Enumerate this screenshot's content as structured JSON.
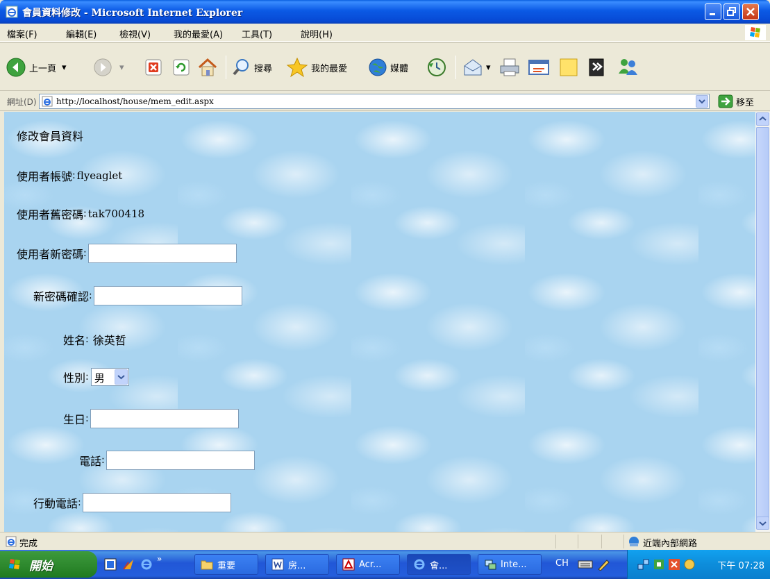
{
  "window": {
    "title": "會員資料修改 - Microsoft Internet Explorer"
  },
  "menu": [
    "檔案(F)",
    "編輯(E)",
    "檢視(V)",
    "我的最愛(A)",
    "工具(T)",
    "說明(H)"
  ],
  "toolbar": {
    "back_label": "上一頁",
    "search_label": "搜尋",
    "favorites_label": "我的最愛",
    "media_label": "媒體"
  },
  "address": {
    "label": "網址(D)",
    "url": "http://localhost/house/mem_edit.aspx",
    "go_label": "移至"
  },
  "form": {
    "heading": "修改會員資料",
    "account_label": "使用者帳號",
    "account_value": "flyeaglet",
    "old_password_label": "使用者舊密碼",
    "old_password_value": "tak700418",
    "new_password_label": "使用者新密碼",
    "new_password_value": "",
    "confirm_password_label": "新密碼確認",
    "confirm_password_value": "",
    "name_label": "姓名",
    "name_value": "徐英哲",
    "gender_label": "性別",
    "gender_value": "男",
    "birthday_label": "生日",
    "birthday_value": "",
    "phone_label": "電話",
    "phone_value": "",
    "mobile_label": "行動電話",
    "mobile_value": ""
  },
  "status": {
    "text": "完成",
    "zone": "近端內部網路"
  },
  "taskbar": {
    "start_label": "開始",
    "items": [
      "重要",
      "房...",
      "Acr...",
      "會...",
      "Inte..."
    ],
    "language": "CH",
    "clock": "下午 07:28"
  },
  "colors": {
    "title_bar": "#0B5AE5",
    "taskbar": "#245EDC",
    "start_button": "#2F8A2F",
    "page_background": "#A9D4F0"
  }
}
